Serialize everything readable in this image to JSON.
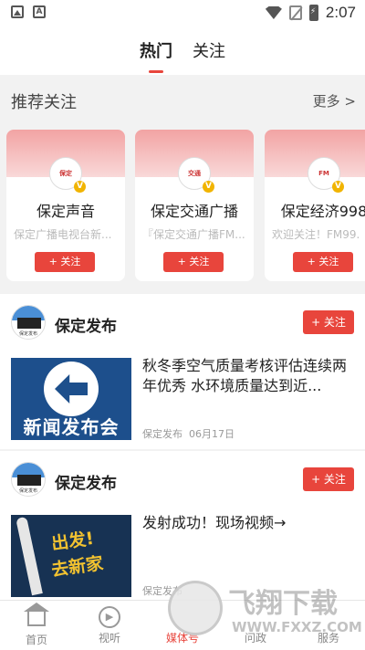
{
  "status_bar": {
    "time": "2:07"
  },
  "tabs": [
    {
      "label": "热门"
    },
    {
      "label": "关注"
    }
  ],
  "recommend": {
    "title": "推荐关注",
    "more": "更多 >",
    "cards": [
      {
        "name": "保定声音",
        "desc": "保定广播电视台新...",
        "follow": "+ 关注"
      },
      {
        "name": "保定交通广播",
        "desc": "『保定交通广播FM...",
        "follow": "+ 关注"
      },
      {
        "name": "保定经济998",
        "desc": "欢迎关注！FM99.",
        "follow": "+ 关注"
      }
    ]
  },
  "feed": [
    {
      "source": "保定发布",
      "follow": "+ 关注",
      "thumb_text": "新闻发布会",
      "headline": "秋冬季空气质量考核评估连续两年优秀 水环境质量达到近...",
      "meta_source": "保定发布",
      "meta_date": "06月17日"
    },
    {
      "source": "保定发布",
      "follow": "+ 关注",
      "thumb_line1": "出发!",
      "thumb_line2": "去新家",
      "headline": "发射成功！现场视频→",
      "meta_source": "保定发布"
    }
  ],
  "bottom_nav": [
    {
      "label": "首页",
      "icon": "home-icon"
    },
    {
      "label": "视听",
      "icon": "play-icon"
    },
    {
      "label": "媒体号",
      "icon": "media-icon"
    },
    {
      "label": "问政",
      "icon": "ask-icon"
    },
    {
      "label": "服务",
      "icon": "service-icon"
    }
  ],
  "watermark": {
    "text": "飞翔下载",
    "url": "WWW.FXXZ.COM"
  },
  "colors": {
    "accent": "#e8453c",
    "card_band": "#f2a3a3"
  }
}
